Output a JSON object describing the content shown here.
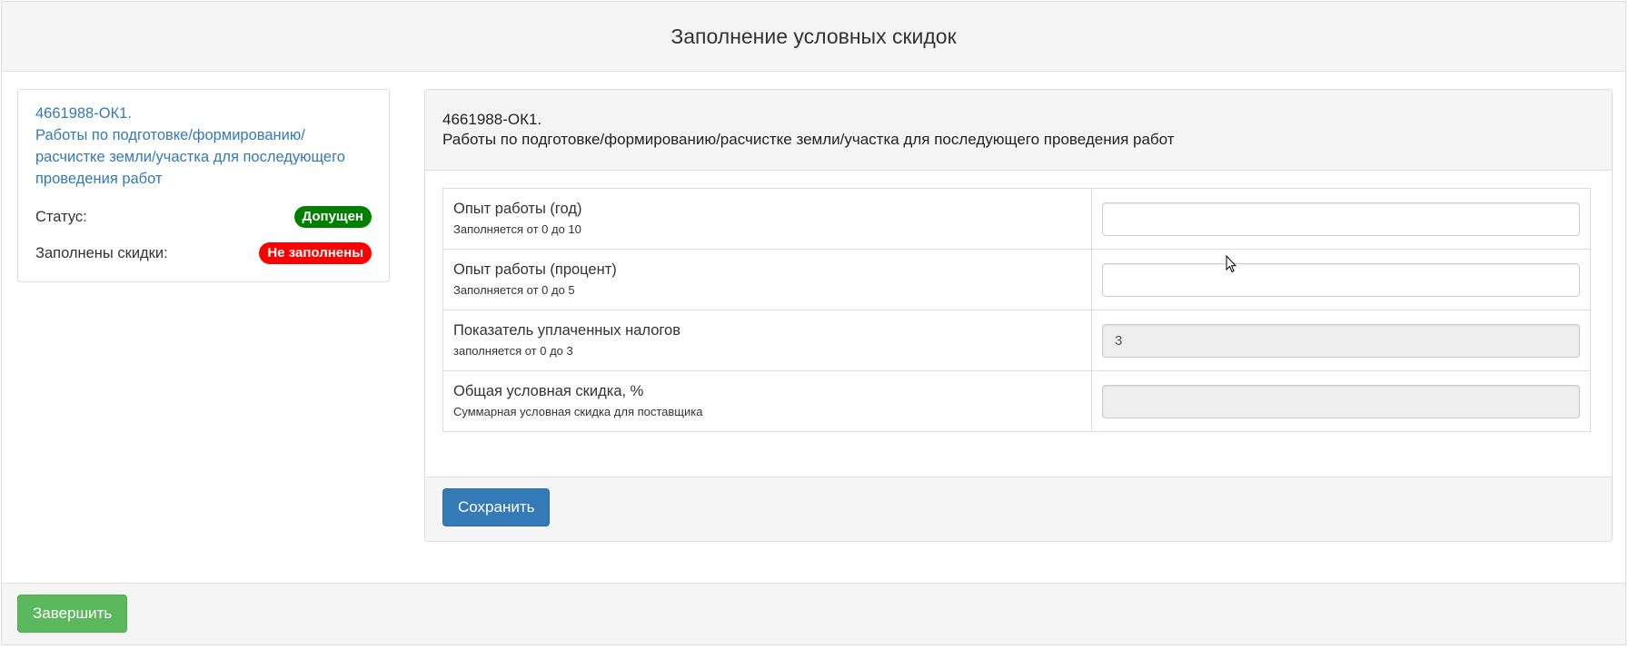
{
  "modal": {
    "title": "Заполнение условных скидок"
  },
  "info": {
    "lot_line1": "4661988-ОК1.",
    "lot_line2": "Работы по подготовке/формированию/расчистке земли/участка для последующего проведения работ",
    "status_label": "Статус:",
    "status_value": "Допущен",
    "discounts_label": "Заполнены скидки:",
    "discounts_value": "Не заполнены",
    "colors": {
      "status_ok": "#008000",
      "status_not_filled": "#ff0000",
      "link": "#337ab7"
    }
  },
  "panel": {
    "heading_line1": "4661988-ОК1.",
    "heading_line2": "Работы по подготовке/формированию/расчистке земли/участка для последующего проведения работ",
    "rows": [
      {
        "name": "Опыт работы (год)",
        "hint": "Заполняется от 0 до 10",
        "value": "",
        "disabled": false
      },
      {
        "name": "Опыт работы (процент)",
        "hint": "Заполняется от 0 до 5",
        "value": "",
        "disabled": false
      },
      {
        "name": "Показатель уплаченных налогов",
        "hint": "заполняется от 0 до 3",
        "value": "3",
        "disabled": true
      },
      {
        "name": "Общая условная скидка, %",
        "hint": "Суммарная условная скидка для поставщика",
        "value": "",
        "disabled": true
      }
    ],
    "save_label": "Сохранить"
  },
  "footer": {
    "finish_label": "Завершить"
  }
}
